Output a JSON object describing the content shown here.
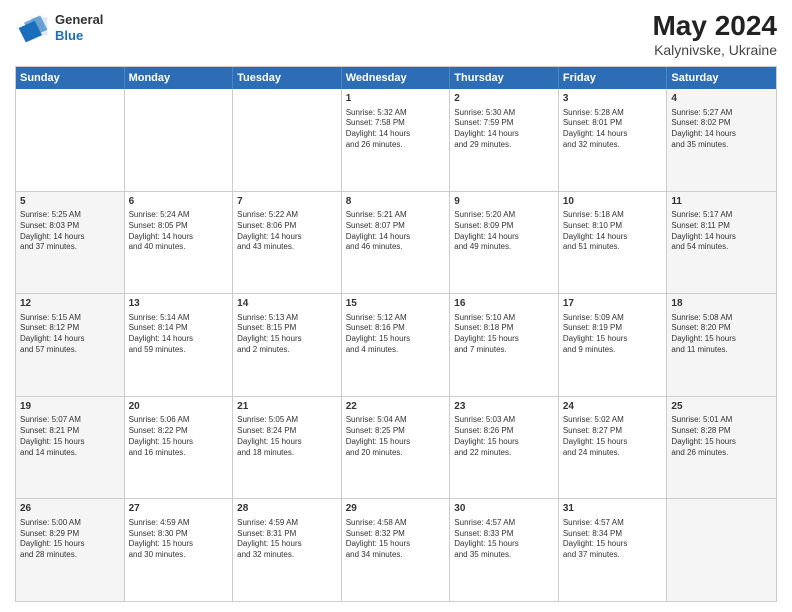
{
  "header": {
    "logo": {
      "general": "General",
      "blue": "Blue"
    },
    "title": "May 2024",
    "location": "Kalynivske, Ukraine"
  },
  "days_of_week": [
    "Sunday",
    "Monday",
    "Tuesday",
    "Wednesday",
    "Thursday",
    "Friday",
    "Saturday"
  ],
  "weeks": [
    [
      {
        "day": "",
        "content": "",
        "shaded": false
      },
      {
        "day": "",
        "content": "",
        "shaded": false
      },
      {
        "day": "",
        "content": "",
        "shaded": false
      },
      {
        "day": "1",
        "content": "Sunrise: 5:32 AM\nSunset: 7:58 PM\nDaylight: 14 hours\nand 26 minutes.",
        "shaded": false
      },
      {
        "day": "2",
        "content": "Sunrise: 5:30 AM\nSunset: 7:59 PM\nDaylight: 14 hours\nand 29 minutes.",
        "shaded": false
      },
      {
        "day": "3",
        "content": "Sunrise: 5:28 AM\nSunset: 8:01 PM\nDaylight: 14 hours\nand 32 minutes.",
        "shaded": false
      },
      {
        "day": "4",
        "content": "Sunrise: 5:27 AM\nSunset: 8:02 PM\nDaylight: 14 hours\nand 35 minutes.",
        "shaded": true
      }
    ],
    [
      {
        "day": "5",
        "content": "Sunrise: 5:25 AM\nSunset: 8:03 PM\nDaylight: 14 hours\nand 37 minutes.",
        "shaded": true
      },
      {
        "day": "6",
        "content": "Sunrise: 5:24 AM\nSunset: 8:05 PM\nDaylight: 14 hours\nand 40 minutes.",
        "shaded": false
      },
      {
        "day": "7",
        "content": "Sunrise: 5:22 AM\nSunset: 8:06 PM\nDaylight: 14 hours\nand 43 minutes.",
        "shaded": false
      },
      {
        "day": "8",
        "content": "Sunrise: 5:21 AM\nSunset: 8:07 PM\nDaylight: 14 hours\nand 46 minutes.",
        "shaded": false
      },
      {
        "day": "9",
        "content": "Sunrise: 5:20 AM\nSunset: 8:09 PM\nDaylight: 14 hours\nand 49 minutes.",
        "shaded": false
      },
      {
        "day": "10",
        "content": "Sunrise: 5:18 AM\nSunset: 8:10 PM\nDaylight: 14 hours\nand 51 minutes.",
        "shaded": false
      },
      {
        "day": "11",
        "content": "Sunrise: 5:17 AM\nSunset: 8:11 PM\nDaylight: 14 hours\nand 54 minutes.",
        "shaded": true
      }
    ],
    [
      {
        "day": "12",
        "content": "Sunrise: 5:15 AM\nSunset: 8:12 PM\nDaylight: 14 hours\nand 57 minutes.",
        "shaded": true
      },
      {
        "day": "13",
        "content": "Sunrise: 5:14 AM\nSunset: 8:14 PM\nDaylight: 14 hours\nand 59 minutes.",
        "shaded": false
      },
      {
        "day": "14",
        "content": "Sunrise: 5:13 AM\nSunset: 8:15 PM\nDaylight: 15 hours\nand 2 minutes.",
        "shaded": false
      },
      {
        "day": "15",
        "content": "Sunrise: 5:12 AM\nSunset: 8:16 PM\nDaylight: 15 hours\nand 4 minutes.",
        "shaded": false
      },
      {
        "day": "16",
        "content": "Sunrise: 5:10 AM\nSunset: 8:18 PM\nDaylight: 15 hours\nand 7 minutes.",
        "shaded": false
      },
      {
        "day": "17",
        "content": "Sunrise: 5:09 AM\nSunset: 8:19 PM\nDaylight: 15 hours\nand 9 minutes.",
        "shaded": false
      },
      {
        "day": "18",
        "content": "Sunrise: 5:08 AM\nSunset: 8:20 PM\nDaylight: 15 hours\nand 11 minutes.",
        "shaded": true
      }
    ],
    [
      {
        "day": "19",
        "content": "Sunrise: 5:07 AM\nSunset: 8:21 PM\nDaylight: 15 hours\nand 14 minutes.",
        "shaded": true
      },
      {
        "day": "20",
        "content": "Sunrise: 5:06 AM\nSunset: 8:22 PM\nDaylight: 15 hours\nand 16 minutes.",
        "shaded": false
      },
      {
        "day": "21",
        "content": "Sunrise: 5:05 AM\nSunset: 8:24 PM\nDaylight: 15 hours\nand 18 minutes.",
        "shaded": false
      },
      {
        "day": "22",
        "content": "Sunrise: 5:04 AM\nSunset: 8:25 PM\nDaylight: 15 hours\nand 20 minutes.",
        "shaded": false
      },
      {
        "day": "23",
        "content": "Sunrise: 5:03 AM\nSunset: 8:26 PM\nDaylight: 15 hours\nand 22 minutes.",
        "shaded": false
      },
      {
        "day": "24",
        "content": "Sunrise: 5:02 AM\nSunset: 8:27 PM\nDaylight: 15 hours\nand 24 minutes.",
        "shaded": false
      },
      {
        "day": "25",
        "content": "Sunrise: 5:01 AM\nSunset: 8:28 PM\nDaylight: 15 hours\nand 26 minutes.",
        "shaded": true
      }
    ],
    [
      {
        "day": "26",
        "content": "Sunrise: 5:00 AM\nSunset: 8:29 PM\nDaylight: 15 hours\nand 28 minutes.",
        "shaded": true
      },
      {
        "day": "27",
        "content": "Sunrise: 4:59 AM\nSunset: 8:30 PM\nDaylight: 15 hours\nand 30 minutes.",
        "shaded": false
      },
      {
        "day": "28",
        "content": "Sunrise: 4:59 AM\nSunset: 8:31 PM\nDaylight: 15 hours\nand 32 minutes.",
        "shaded": false
      },
      {
        "day": "29",
        "content": "Sunrise: 4:58 AM\nSunset: 8:32 PM\nDaylight: 15 hours\nand 34 minutes.",
        "shaded": false
      },
      {
        "day": "30",
        "content": "Sunrise: 4:57 AM\nSunset: 8:33 PM\nDaylight: 15 hours\nand 35 minutes.",
        "shaded": false
      },
      {
        "day": "31",
        "content": "Sunrise: 4:57 AM\nSunset: 8:34 PM\nDaylight: 15 hours\nand 37 minutes.",
        "shaded": false
      },
      {
        "day": "",
        "content": "",
        "shaded": true
      }
    ]
  ]
}
